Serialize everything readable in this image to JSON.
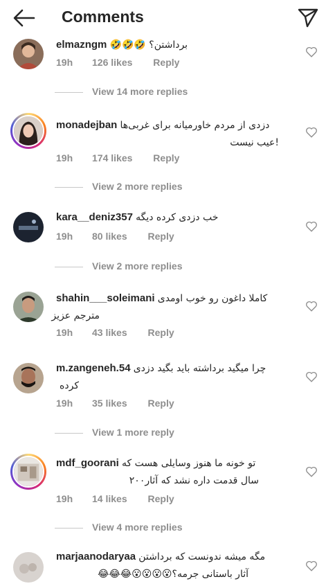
{
  "header": {
    "title": "Comments",
    "back_icon": "arrow-left-icon",
    "share_icon": "paper-plane-icon"
  },
  "comments": [
    {
      "user": "elmazngm",
      "text": "برداشتن؟ 🤣🤣🤣",
      "line2": "",
      "time": "19h",
      "likes": "126 likes",
      "reply": "Reply",
      "more": "View 14 more replies"
    },
    {
      "user": "monadejban",
      "text": "دزدی از مردم خاورمیانه برای غربی‌ها",
      "line2": "!عیب نیست",
      "time": "19h",
      "likes": "174 likes",
      "reply": "Reply",
      "more": "View 2 more replies"
    },
    {
      "user": "kara__deniz357",
      "text": "خب دزدی کرده دیگه",
      "line2": "",
      "time": "19h",
      "likes": "80 likes",
      "reply": "Reply",
      "more": "View 2 more replies"
    },
    {
      "user": "shahin___soleimani",
      "text": "کاملا داغون رو خوب اومدی",
      "line2": "مترجم عزیز",
      "time": "19h",
      "likes": "43 likes",
      "reply": "Reply",
      "more": ""
    },
    {
      "user": "m.zangeneh.54",
      "text": "چرا میگید برداشته باید بگید دزدی",
      "line2": "کرده",
      "time": "19h",
      "likes": "35 likes",
      "reply": "Reply",
      "more": "View 1 more reply"
    },
    {
      "user": "mdf_goorani",
      "text": "تو خونه ما هنوز وسایلی هست که",
      "line2": "سال قدمت داره نشد که آثار۲۰۰",
      "time": "19h",
      "likes": "14 likes",
      "reply": "Reply",
      "more": "View 4 more replies"
    },
    {
      "user": "marjaanodaryaa",
      "text": "مگه میشه ندونست که برداشتن",
      "line2": "آثار باستانی جرمه؟😮😮😮😮😂😂😂",
      "time": "",
      "likes": "",
      "reply": "",
      "more": ""
    }
  ]
}
